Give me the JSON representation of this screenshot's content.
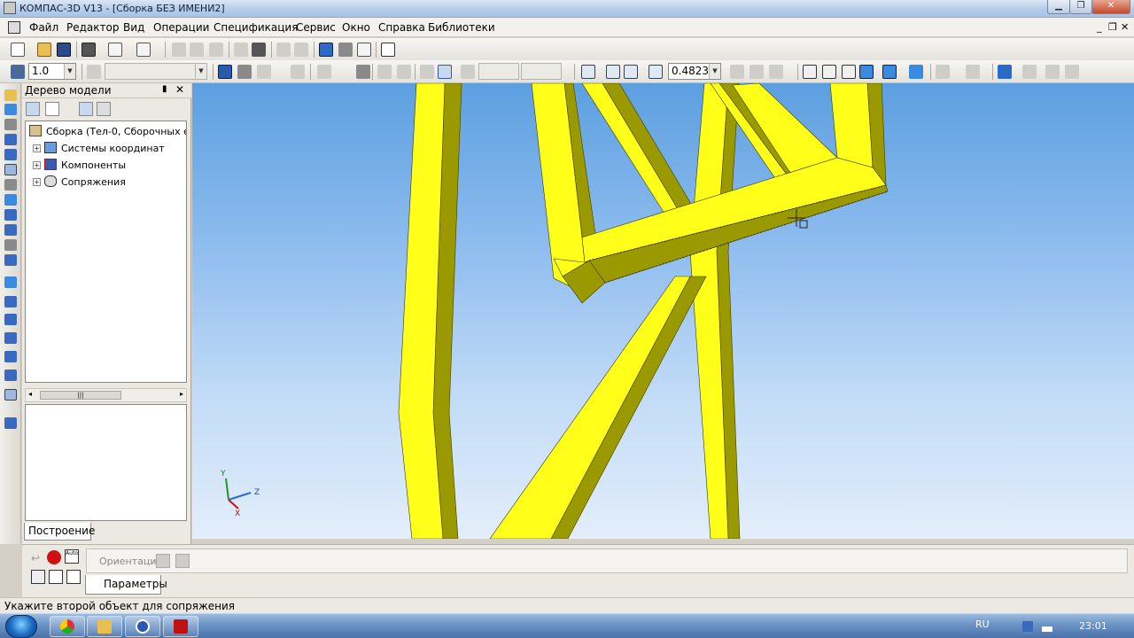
{
  "window": {
    "title": "КОМПАС-3D V13 - [Сборка БЕЗ ИМЕНИ2]",
    "minimize": "▁",
    "maximize": "❐",
    "close": "✕"
  },
  "menu": {
    "items": [
      "Файл",
      "Редактор",
      "Вид",
      "Операции",
      "Спецификация",
      "Сервис",
      "Окно",
      "Справка",
      "Библиотеки"
    ],
    "mdi_min": "_",
    "mdi_restore": "❐",
    "mdi_close": "✕"
  },
  "toolbar2": {
    "step_value": "1.0",
    "zoom_value": "0.4823"
  },
  "tree": {
    "title": "Дерево модели",
    "pin": "▮",
    "close": "✕",
    "root": "Сборка (Тел-0, Сборочных е",
    "children": [
      "Системы координат",
      "Компоненты",
      "Сопряжения"
    ],
    "scroll_left": "◂",
    "scroll_right": "▸",
    "scroll_grip": "|||",
    "tab_build": "Построение"
  },
  "axes": {
    "y": "Y",
    "z": "Z",
    "x": "X"
  },
  "propbar": {
    "orientation_label": "Ориентация",
    "tab_params": "Параметры",
    "auto_label": "Auto"
  },
  "status": {
    "message": "Укажите второй объект для сопряжения"
  },
  "taskbar": {
    "lang": "RU",
    "clock": "23:01"
  },
  "colors": {
    "beam_face": "#ffff1a",
    "beam_side": "#9a9a00",
    "sky_top": "#5c9fe0",
    "sky_bottom": "#e3eefb"
  }
}
